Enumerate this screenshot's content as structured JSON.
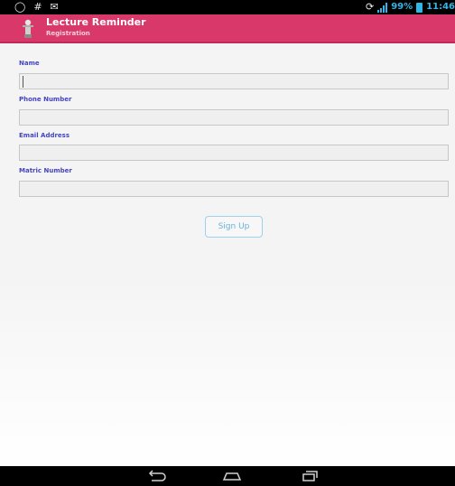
{
  "status_bar": {
    "battery_percent": "99%",
    "time": "11:46",
    "icons": [
      "circle-icon",
      "hash-icon",
      "mail-icon",
      "rotate-icon",
      "signal-icon",
      "battery-icon"
    ]
  },
  "action_bar": {
    "title": "Lecture Reminder",
    "subtitle": "Registration",
    "background_color": "#d8386a"
  },
  "form": {
    "fields": [
      {
        "label": "Name",
        "value": ""
      },
      {
        "label": "Phone Number",
        "value": ""
      },
      {
        "label": "Email Address",
        "value": ""
      },
      {
        "label": "Matric Number",
        "value": ""
      }
    ],
    "signup_label": "Sign Up",
    "label_color": "#4545c0",
    "button_text_color": "#6ab0dd"
  },
  "nav_bar": {
    "icons": [
      "back-icon",
      "home-icon",
      "recent-apps-icon"
    ]
  }
}
